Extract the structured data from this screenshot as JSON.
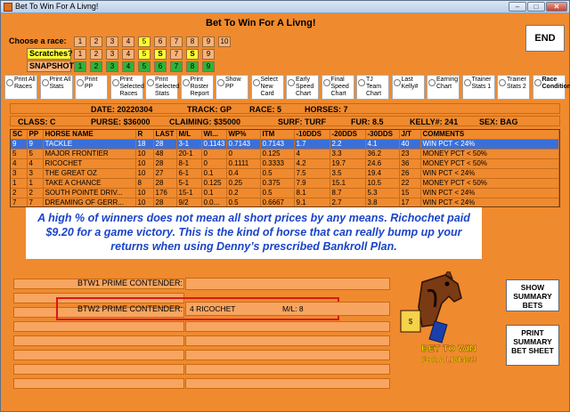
{
  "window": {
    "title": "Bet To Win For A Livng!",
    "min": "–",
    "max": "□",
    "close": "✕"
  },
  "app_title": "Bet To Win For A Livng!",
  "end_label": "END",
  "rows": {
    "race_label": "Choose  a race:",
    "scratch_label": "Scratches?",
    "snapshot_label": "SNAPSHOT",
    "races": [
      "1",
      "2",
      "3",
      "4",
      "5",
      "6",
      "7",
      "8",
      "9",
      "10"
    ],
    "scratches": [
      "1",
      "2",
      "3",
      "4",
      "5",
      "S",
      "7",
      "S",
      "9"
    ],
    "snapshots": [
      "1",
      "2",
      "3",
      "4",
      "5",
      "6",
      "7",
      "8",
      "9"
    ]
  },
  "options": [
    "Print All Races",
    "Print All Stats",
    "Print PP",
    "Print Selected Races",
    "Print Selected Stats",
    "Print Roster Report",
    "Show PP",
    "Select New Card",
    "Early Speed Chart",
    "Final Speed Chart",
    "TJ Team Chart",
    "Last Kelly#",
    "Earning Chart",
    "Trainer Stats 1",
    "Trainer Stats 2",
    "Race Conditions"
  ],
  "race_info": {
    "date": "DATE: 20220304",
    "track": "TRACK: GP",
    "race": "RACE: 5",
    "horses": "HORSES: 7",
    "class": "CLASS: C",
    "purse": "PURSE: $36000",
    "claiming": "CLAIMING: $35000",
    "surf": "SURF: TURF",
    "fur": "FUR: 8.5",
    "kelly": "KELLY#: 241",
    "sex": "SEX: BAG"
  },
  "table": {
    "headers": [
      "SC",
      "PP",
      "HORSE NAME",
      "R",
      "LAST",
      "M/L",
      "WI...",
      "WP%",
      "ITM",
      "-10DDS",
      "-20DDS",
      "-30DDS",
      "J/T",
      "COMMENTS"
    ],
    "rows": [
      [
        "9",
        "9",
        "TACKLE",
        "18",
        "28",
        "3-1",
        "0.1143",
        "0.7143",
        "0.7143",
        "1.7",
        "2.2",
        "4.1",
        "40",
        "WIN PCT < 24%"
      ],
      [
        "5",
        "5",
        "MAJOR FRONTIER",
        "10",
        "48",
        "20-1",
        "0",
        "0",
        "0.125",
        "4",
        "3.3",
        "36.2",
        "23",
        "MONEY PCT < 50%"
      ],
      [
        "4",
        "4",
        "RICOCHET",
        "10",
        "28",
        "8-1",
        "0",
        "0.1111",
        "0.3333",
        "4.2",
        "19.7",
        "24.6",
        "36",
        "MONEY PCT < 50%"
      ],
      [
        "3",
        "3",
        "THE GREAT OZ",
        "10",
        "27",
        "6-1",
        "0.1",
        "0.4",
        "0.5",
        "7.5",
        "3.5",
        "19.4",
        "26",
        "WIN PCT < 24%"
      ],
      [
        "1",
        "1",
        "TAKE A CHANCE",
        "8",
        "28",
        "5-1",
        "0.125",
        "0.25",
        "0.375",
        "7.9",
        "15.1",
        "10.5",
        "22",
        "MONEY PCT < 50%"
      ],
      [
        "2",
        "2",
        "SOUTH POINTE DRIV...",
        "10",
        "176",
        "15-1",
        "0.1",
        "0.2",
        "0.5",
        "8.1",
        "8.7",
        "5.3",
        "15",
        "WIN PCT < 24%"
      ],
      [
        "7",
        "7",
        "DREAMING OF GERR...",
        "10",
        "28",
        "9/2",
        "0.0...",
        "0.5",
        "0.6667",
        "9.1",
        "2.7",
        "3.8",
        "17",
        "WIN PCT < 24%"
      ]
    ]
  },
  "overlay_text": "A high % of winners does not mean all short prices by any means.  Richochet paid $9.20 for a game victory.  This is the kind of horse that can really bump up your returns when using Denny’s prescribed Bankroll Plan.",
  "contenders": {
    "btw1_label": "BTW1 PRIME CONTENDER:",
    "btw2_label": "BTW2 PRIME CONTENDER:",
    "btw2_horse": "4  RICOCHET",
    "btw2_ml": "M/L:  8"
  },
  "buttons": {
    "show_summary": "SHOW SUMMARY BETS",
    "print_summary": "PRINT SUMMARY BET SHEET"
  },
  "logo_text": "BET TO WIN FOR A LIVING!!",
  "colors": {
    "background": "#f08a2e",
    "selected_row": "#3b6fd8",
    "overlay_text": "#1a44c8",
    "highlight_frame": "#d81818"
  }
}
